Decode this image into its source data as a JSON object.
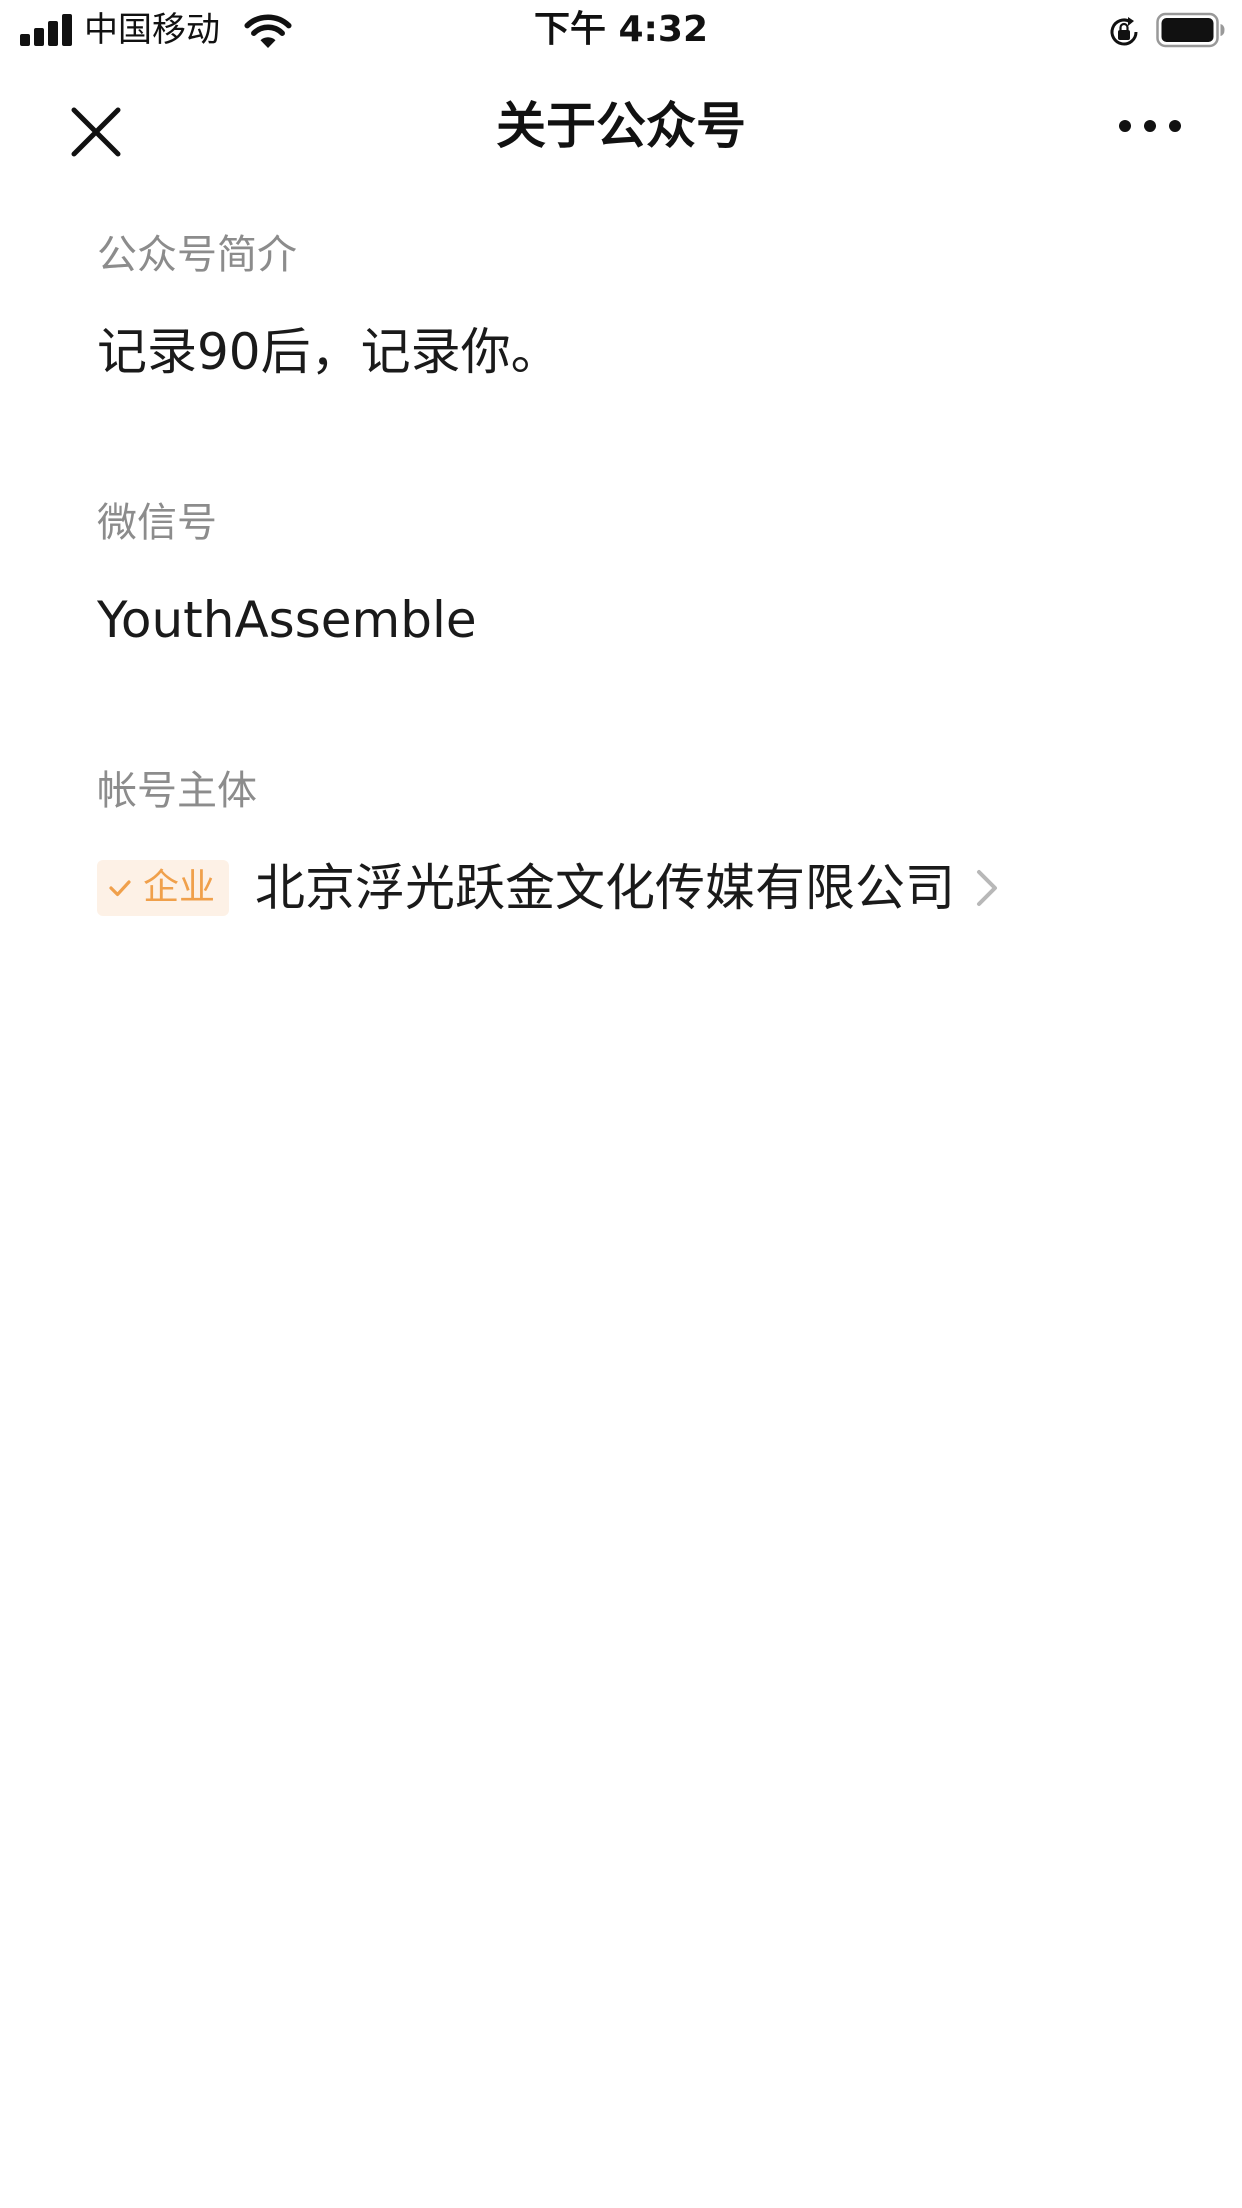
{
  "status_bar": {
    "carrier": "中国移动",
    "time": "下午 4:32",
    "icons": [
      "signal-icon",
      "wifi-icon",
      "rotation-lock-icon",
      "battery-icon"
    ]
  },
  "nav": {
    "title": "关于公众号",
    "left_icon": "close-icon",
    "right_icon": "more-icon"
  },
  "sections": {
    "intro": {
      "label": "公众号简介",
      "value": "记录90后，记录你。"
    },
    "wechat_id": {
      "label": "微信号",
      "value": "YouthAssemble"
    },
    "entity": {
      "label": "帐号主体",
      "badge": "企业",
      "badge_icon": "check-icon",
      "name": "北京浮光跃金文化传媒有限公司",
      "trailing_icon": "chevron-right-icon"
    }
  },
  "colors": {
    "badge_text": "#f0a04b",
    "badge_background": "#fdf1e6",
    "label_gray": "#8c8c8c",
    "text": "#1a1a1a"
  }
}
